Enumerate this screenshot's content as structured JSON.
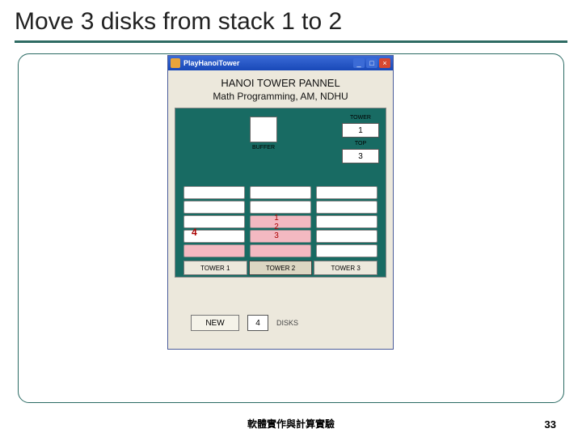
{
  "slide": {
    "title": "Move 3 disks from stack 1 to 2",
    "footer": "軟體實作與計算實驗",
    "page_number": "33"
  },
  "window": {
    "title": "PlayHanoiTower",
    "heading1": "HANOI TOWER PANNEL",
    "heading2": "Math Programming, AM, NDHU",
    "labels": {
      "buffer": "BUFFER",
      "tower": "TOWER",
      "top": "TOP",
      "disks": "DISKS"
    },
    "fields": {
      "tower": "1",
      "top": "3",
      "disks": "4"
    },
    "tower1_count": "4",
    "tower2_nums": [
      "1",
      "2",
      "3"
    ],
    "radio": {
      "options": [
        "TOWER 1",
        "TOWER 2",
        "TOWER 3"
      ],
      "selected_index": 1
    },
    "buttons": {
      "new": "NEW"
    }
  }
}
